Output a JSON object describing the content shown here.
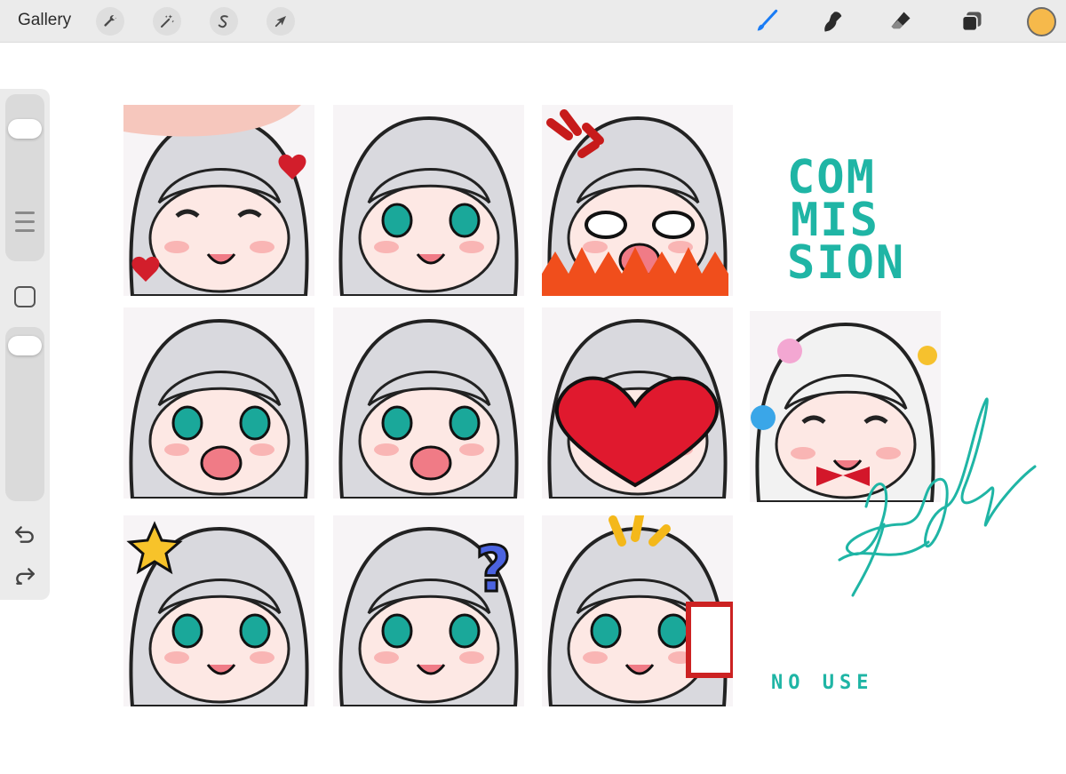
{
  "toolbar": {
    "gallery_label": "Gallery",
    "left_tools": [
      {
        "name": "actions",
        "icon": "wrench-icon"
      },
      {
        "name": "adjustments",
        "icon": "magic-wand-icon"
      },
      {
        "name": "selection",
        "icon": "selection-s-icon"
      },
      {
        "name": "transform",
        "icon": "arrow-cursor-icon"
      }
    ],
    "right_tools": [
      {
        "name": "brush",
        "icon": "brush-icon",
        "active": true
      },
      {
        "name": "smudge",
        "icon": "smudge-icon"
      },
      {
        "name": "eraser",
        "icon": "eraser-icon"
      },
      {
        "name": "layers",
        "icon": "layers-icon"
      }
    ],
    "current_color": "#f6b94b",
    "accent_color": "#1a7cf5"
  },
  "sidebar": {
    "icons": [
      "modifier-square-icon",
      "undo-icon",
      "redo-icon"
    ]
  },
  "canvas": {
    "sketch_lines": [
      "COM",
      "MIS",
      "SION"
    ],
    "note": "NO USE",
    "sketch_color": "#1fb5a5"
  }
}
